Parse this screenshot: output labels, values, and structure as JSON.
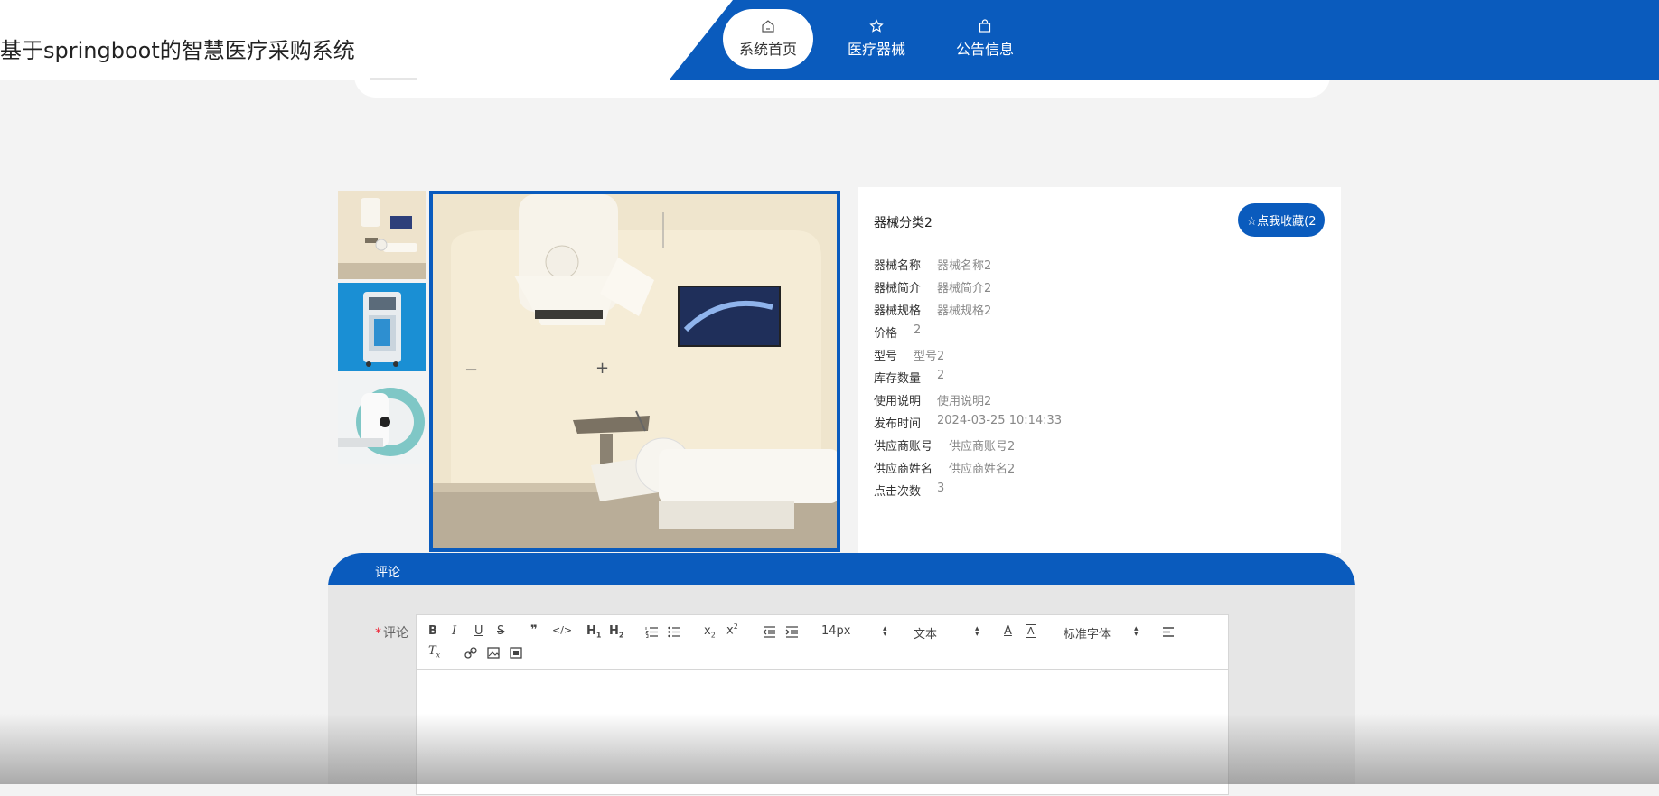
{
  "header": {
    "site_title": "基于springboot的智慧医疗采购系统",
    "nav": [
      {
        "label": "系统首页",
        "icon": "home-icon",
        "active": true
      },
      {
        "label": "医疗器械",
        "icon": "star-icon",
        "active": false
      },
      {
        "label": "公告信息",
        "icon": "shopping-bag-icon",
        "active": false
      }
    ]
  },
  "colors": {
    "brand": "#0a5bbd",
    "background": "#f3f3f3",
    "required": "#e23"
  },
  "product": {
    "category": "器械分类2",
    "favorite_label": "☆点我收藏(2",
    "fields": [
      {
        "key": "器械名称",
        "value": "器械名称2"
      },
      {
        "key": "器械简介",
        "value": "器械简介2"
      },
      {
        "key": "器械规格",
        "value": "器械规格2"
      },
      {
        "key": "价格",
        "value": "2"
      },
      {
        "key": "型号",
        "value": "型号2"
      },
      {
        "key": "库存数量",
        "value": "2"
      },
      {
        "key": "使用说明",
        "value": "使用说明2"
      },
      {
        "key": "发布时间",
        "value": "2024-03-25 10:14:33"
      },
      {
        "key": "供应商账号",
        "value": "供应商账号2"
      },
      {
        "key": "供应商姓名",
        "value": "供应商姓名2"
      },
      {
        "key": "点击次数",
        "value": "3"
      }
    ],
    "thumbnails": [
      "radiotherapy-room-thumbnail",
      "medical-cart-thumbnail",
      "ct-scanner-thumbnail"
    ],
    "main_image": "radiotherapy-room-image"
  },
  "comment": {
    "section_title": "评论",
    "required_mark": "*",
    "label": "评论",
    "toolbar": {
      "font_size": "14px",
      "header_type": "文本",
      "font_family": "标准字体"
    }
  }
}
